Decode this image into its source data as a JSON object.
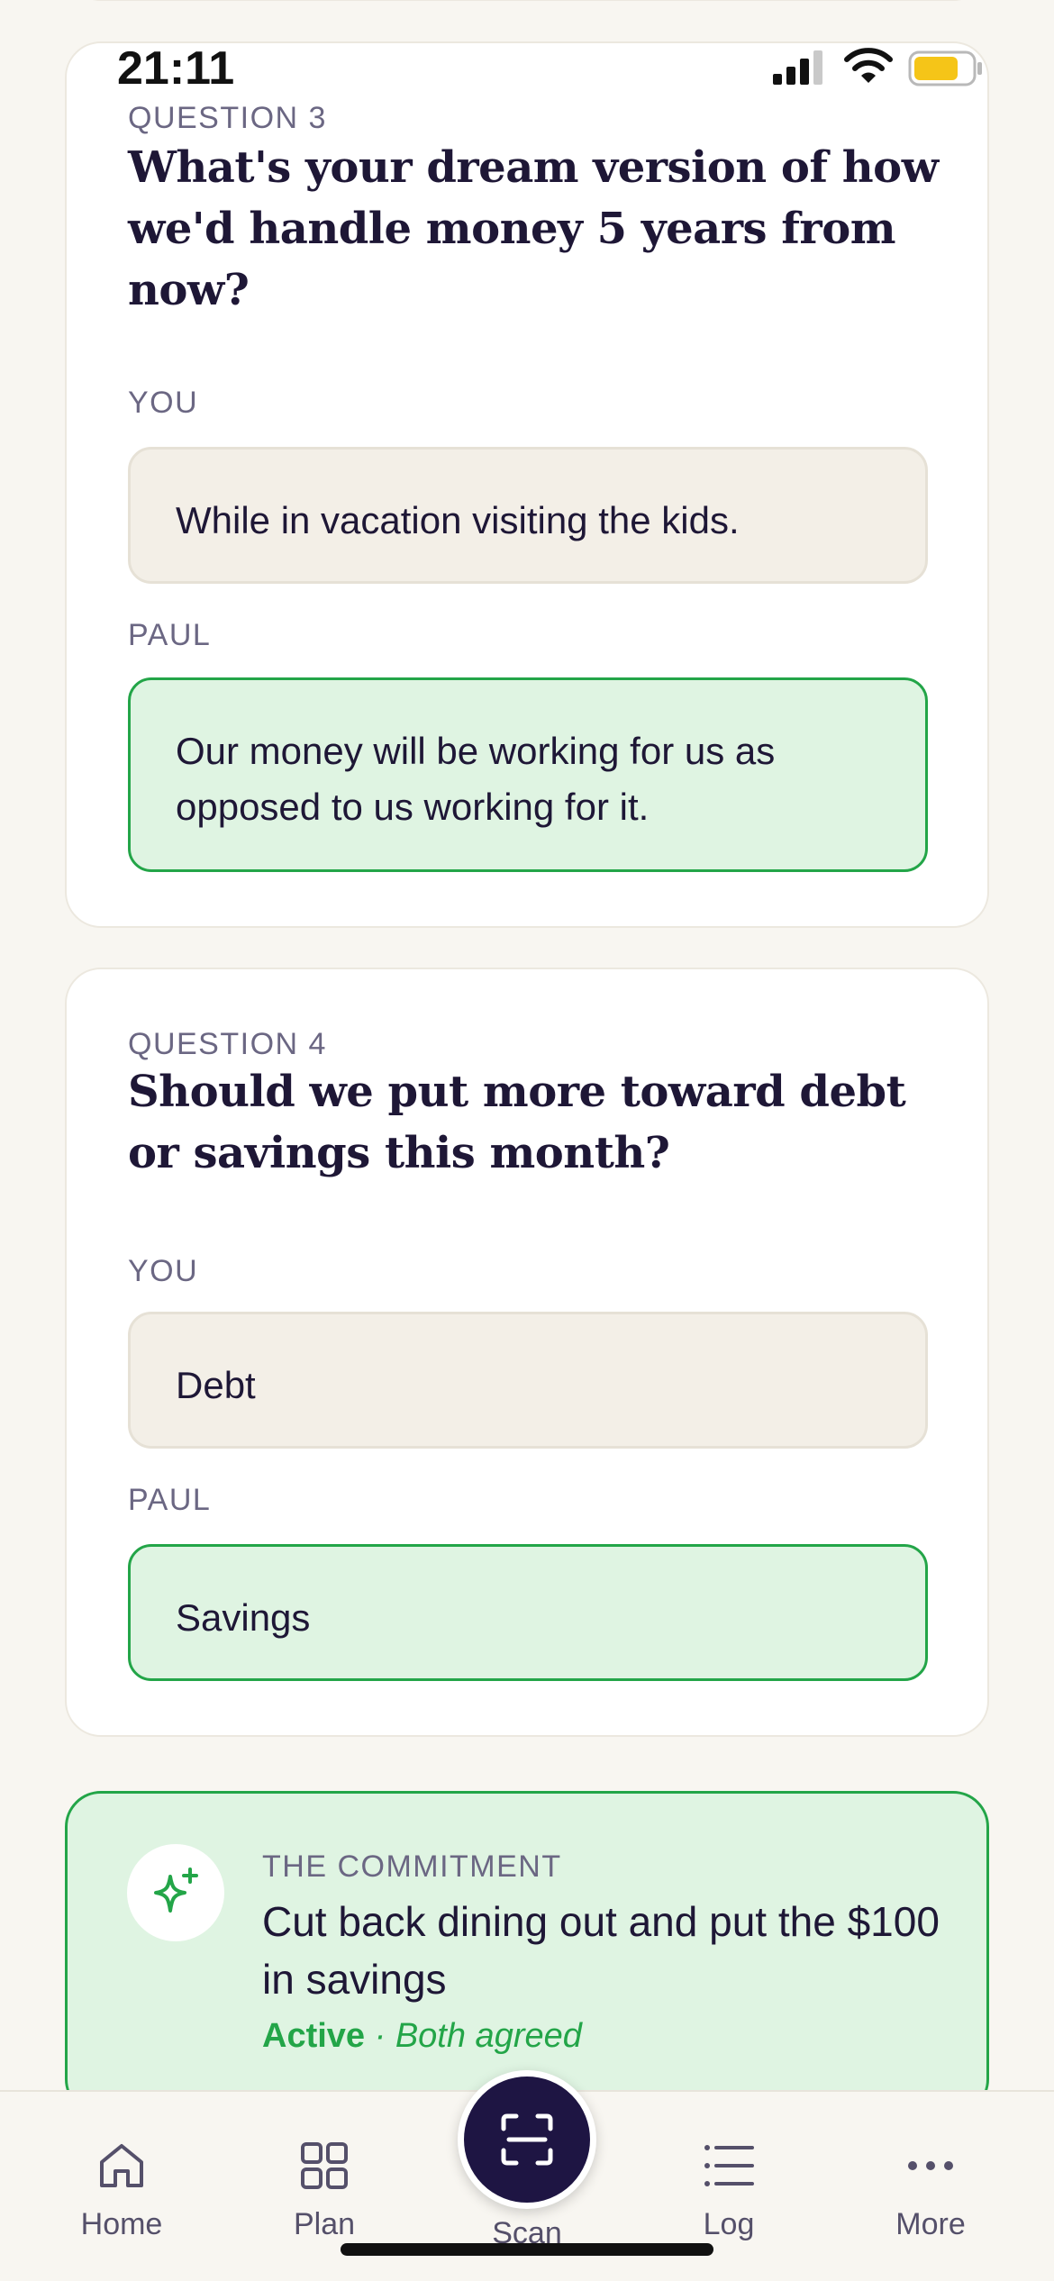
{
  "status_bar": {
    "time": "21:11"
  },
  "questions": [
    {
      "label": "QUESTION 3",
      "title": "What's your dream version of how we'd handle money 5 years from now?",
      "you_label": "YOU",
      "you_answer": "While in vacation visiting the kids.",
      "partner_label": "PAUL",
      "partner_answer": "Our money will be working for us as opposed to us working for it."
    },
    {
      "label": "QUESTION 4",
      "title": "Should we put more toward debt or savings this month?",
      "you_label": "YOU",
      "you_answer": "Debt",
      "partner_label": "PAUL",
      "partner_answer": "Savings"
    }
  ],
  "commitment": {
    "label": "THE COMMITMENT",
    "text": "Cut back dining out and put the $100 in savings",
    "status": "Active",
    "status_detail": " · Both agreed",
    "icon": "sparkle-icon"
  },
  "tabbar": {
    "home": "Home",
    "plan": "Plan",
    "scan": "Scan",
    "log": "Log",
    "more": "More"
  },
  "colors": {
    "background": "#f8f6f1",
    "accent_green": "#23a548",
    "partner_bg": "#dff4e2",
    "you_bg": "#f3efe7",
    "navy": "#1e1543"
  }
}
